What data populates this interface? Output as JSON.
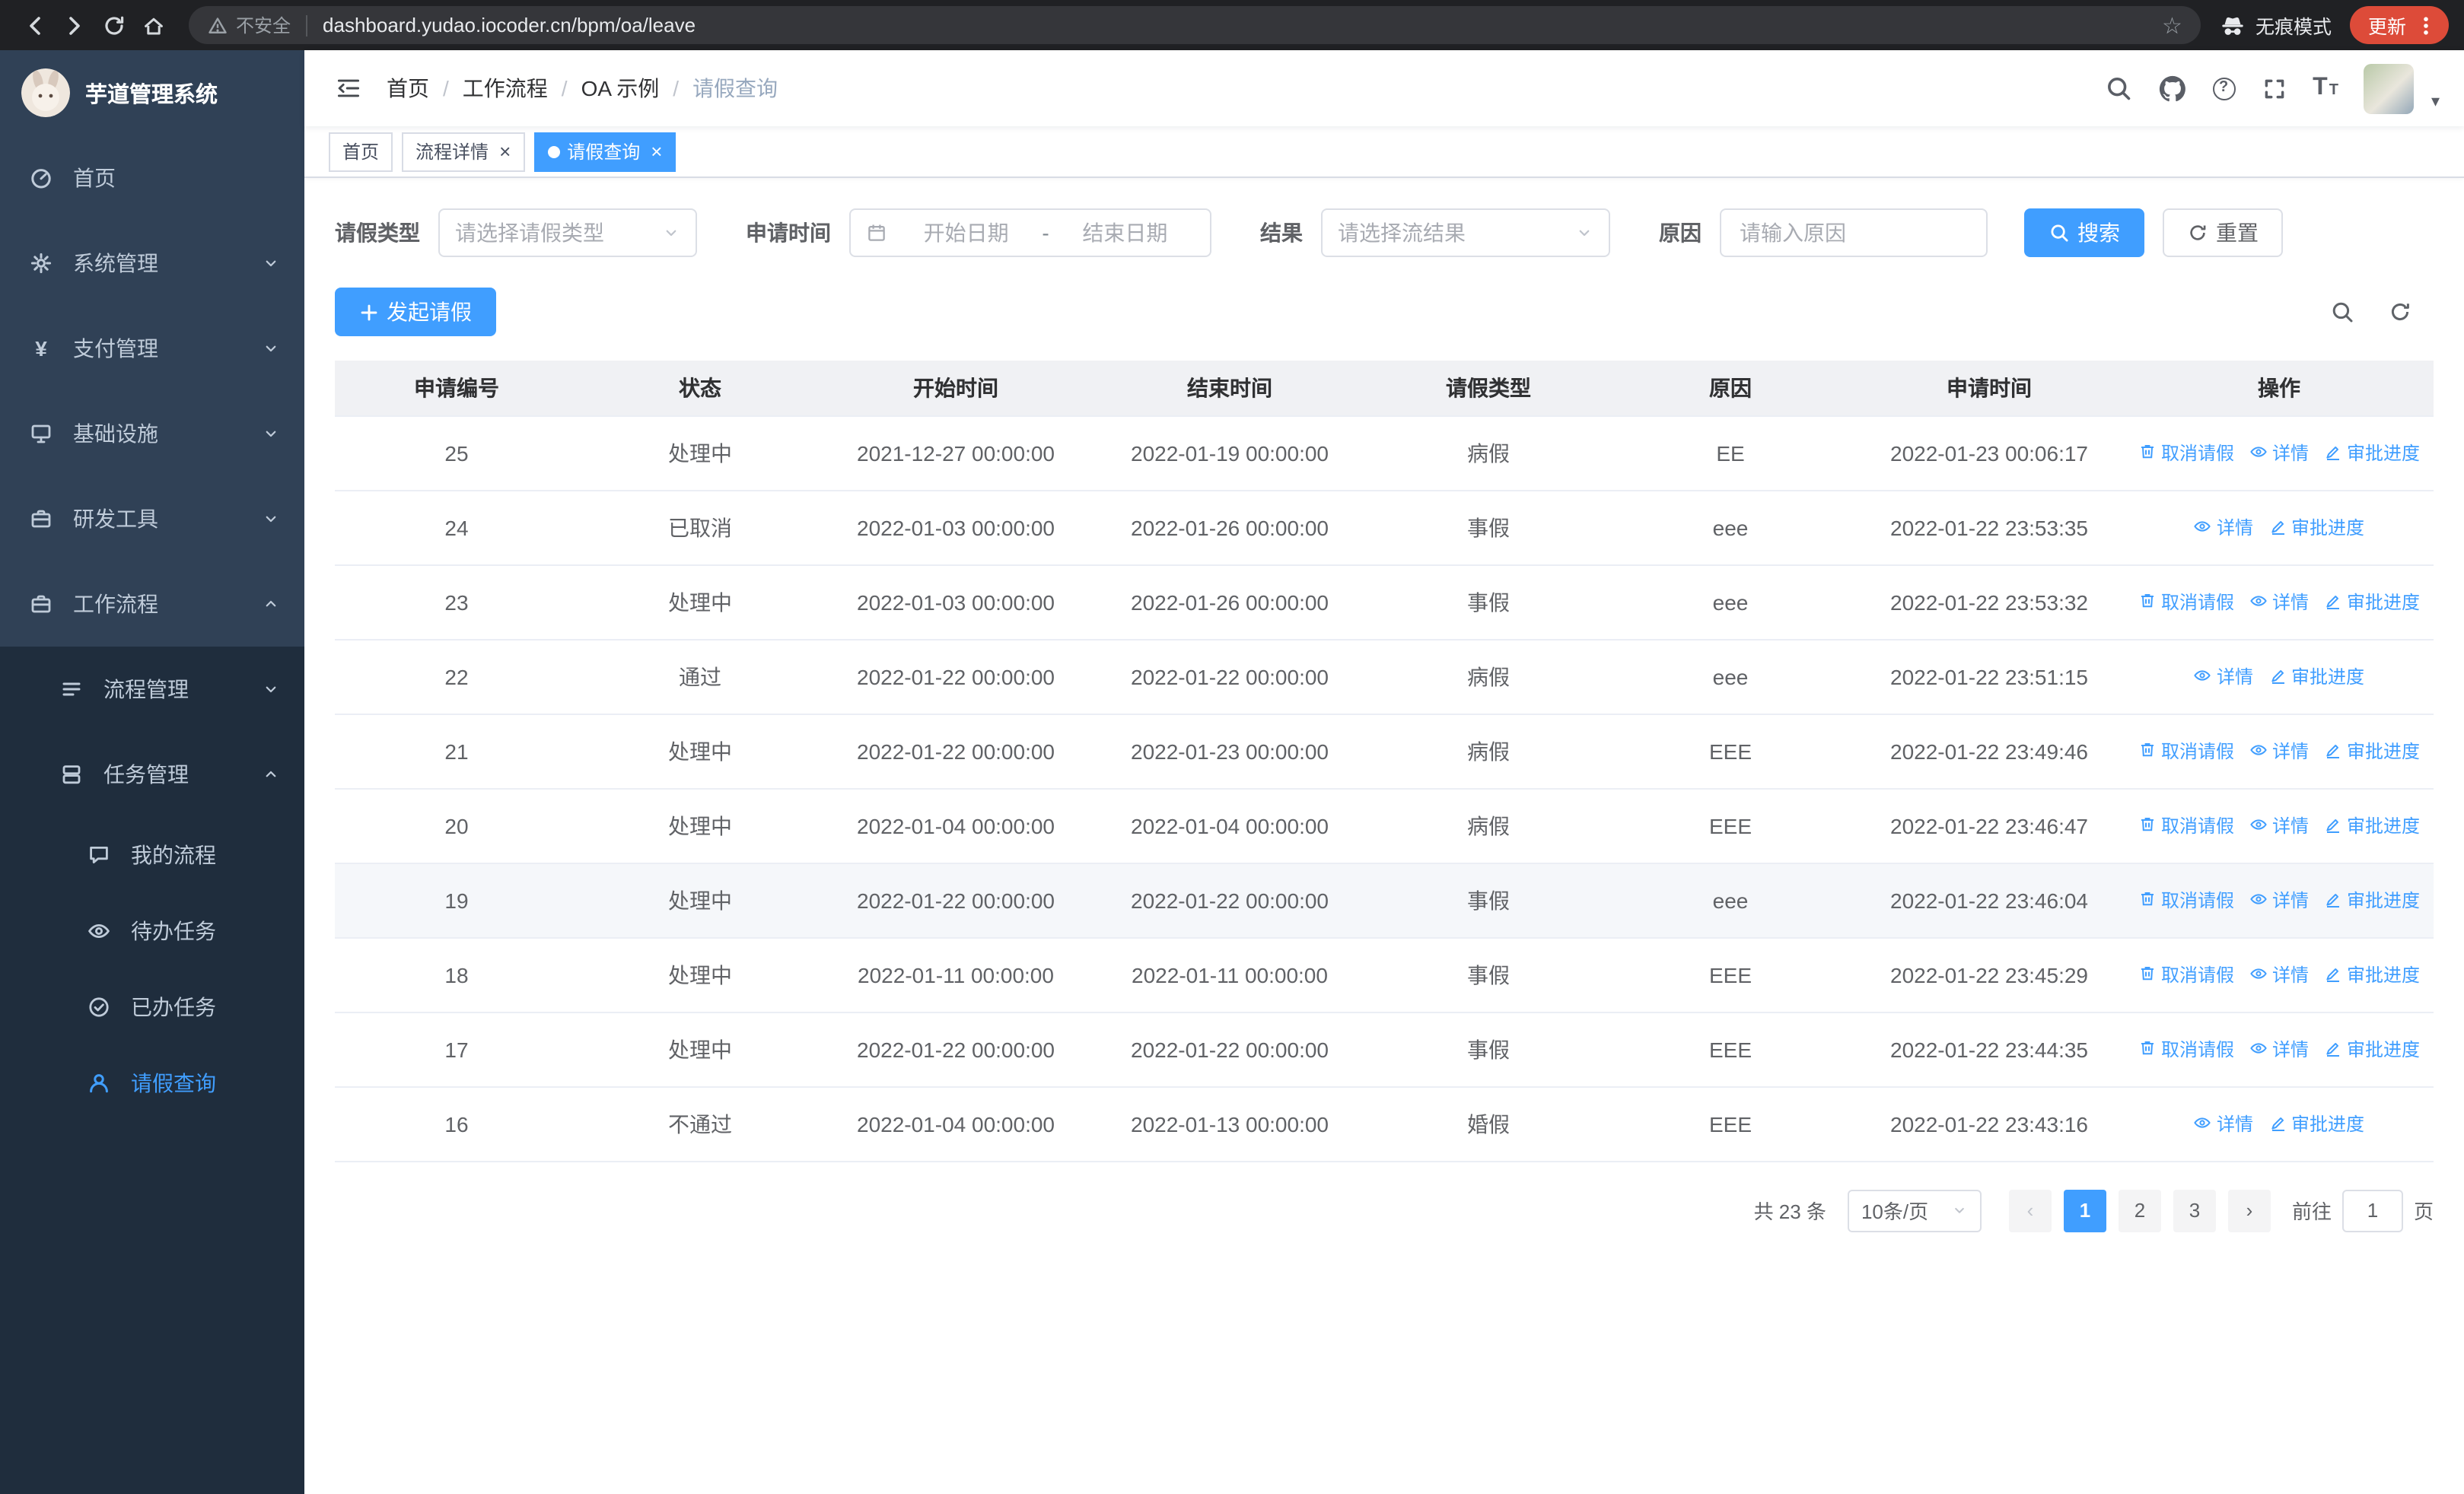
{
  "browser": {
    "security_label": "不安全",
    "url": "dashboard.yudao.iocoder.cn/bpm/oa/leave",
    "incognito_label": "无痕模式",
    "update_label": "更新"
  },
  "icons": {
    "star": "☆",
    "close": "×",
    "caret_down": "▾",
    "prev": "‹",
    "next": "›",
    "question": "?",
    "yen": "¥",
    "font_size": "T"
  },
  "sidebar": {
    "logo_title": "芋道管理系统",
    "items": [
      {
        "label": "首页",
        "icon": "dashboard-icon",
        "level": 1
      },
      {
        "label": "系统管理",
        "icon": "gear-icon",
        "level": 1,
        "expandable": true,
        "expanded": false
      },
      {
        "label": "支付管理",
        "icon": "yen-icon",
        "level": 1,
        "expandable": true,
        "expanded": false
      },
      {
        "label": "基础设施",
        "icon": "monitor-icon",
        "level": 1,
        "expandable": true,
        "expanded": false
      },
      {
        "label": "研发工具",
        "icon": "briefcase-icon",
        "level": 1,
        "expandable": true,
        "expanded": false
      },
      {
        "label": "工作流程",
        "icon": "briefcase-icon",
        "level": 1,
        "expandable": true,
        "expanded": true
      },
      {
        "label": "流程管理",
        "icon": "list-icon",
        "level": 2,
        "expandable": true,
        "expanded": false
      },
      {
        "label": "任务管理",
        "icon": "stacked-icon",
        "level": 2,
        "expandable": true,
        "expanded": true
      },
      {
        "label": "我的流程",
        "icon": "chat-icon",
        "level": 3
      },
      {
        "label": "待办任务",
        "icon": "eye-icon",
        "level": 3
      },
      {
        "label": "已办任务",
        "icon": "check-circle-icon",
        "level": 3
      },
      {
        "label": "请假查询",
        "icon": "user-icon",
        "level": 3,
        "active": true
      }
    ]
  },
  "header": {
    "breadcrumb": [
      "首页",
      "工作流程",
      "OA 示例",
      "请假查询"
    ],
    "breadcrumb_separator": "/",
    "right_icons": [
      "search-icon",
      "github-icon",
      "help-icon",
      "fullscreen-icon",
      "font-size-icon",
      "avatar",
      "caret-down-icon"
    ]
  },
  "tags": [
    {
      "label": "首页",
      "closable": false,
      "active": false
    },
    {
      "label": "流程详情",
      "closable": true,
      "active": false
    },
    {
      "label": "请假查询",
      "closable": true,
      "active": true
    }
  ],
  "filters": {
    "leave_type_label": "请假类型",
    "leave_type_placeholder": "请选择请假类型",
    "apply_time_label": "申请时间",
    "start_date_placeholder": "开始日期",
    "range_separator": "-",
    "end_date_placeholder": "结束日期",
    "result_label": "结果",
    "result_placeholder": "请选择流结果",
    "reason_label": "原因",
    "reason_placeholder": "请输入原因",
    "search_label": "搜索",
    "reset_label": "重置"
  },
  "toolbar": {
    "create_label": "发起请假"
  },
  "table": {
    "columns": [
      "申请编号",
      "状态",
      "开始时间",
      "结束时间",
      "请假类型",
      "原因",
      "申请时间",
      "操作"
    ],
    "action_labels": {
      "cancel": "取消请假",
      "detail": "详情",
      "progress": "审批进度"
    },
    "rows": [
      {
        "id": "25",
        "status": "处理中",
        "start": "2021-12-27 00:00:00",
        "end": "2022-01-19 00:00:00",
        "type": "病假",
        "reason": "EE",
        "apply_time": "2022-01-23 00:06:17",
        "actions": [
          "cancel",
          "detail",
          "progress"
        ]
      },
      {
        "id": "24",
        "status": "已取消",
        "start": "2022-01-03 00:00:00",
        "end": "2022-01-26 00:00:00",
        "type": "事假",
        "reason": "eee",
        "apply_time": "2022-01-22 23:53:35",
        "actions": [
          "detail",
          "progress"
        ]
      },
      {
        "id": "23",
        "status": "处理中",
        "start": "2022-01-03 00:00:00",
        "end": "2022-01-26 00:00:00",
        "type": "事假",
        "reason": "eee",
        "apply_time": "2022-01-22 23:53:32",
        "actions": [
          "cancel",
          "detail",
          "progress"
        ]
      },
      {
        "id": "22",
        "status": "通过",
        "start": "2022-01-22 00:00:00",
        "end": "2022-01-22 00:00:00",
        "type": "病假",
        "reason": "eee",
        "apply_time": "2022-01-22 23:51:15",
        "actions": [
          "detail",
          "progress"
        ]
      },
      {
        "id": "21",
        "status": "处理中",
        "start": "2022-01-22 00:00:00",
        "end": "2022-01-23 00:00:00",
        "type": "病假",
        "reason": "EEE",
        "apply_time": "2022-01-22 23:49:46",
        "actions": [
          "cancel",
          "detail",
          "progress"
        ]
      },
      {
        "id": "20",
        "status": "处理中",
        "start": "2022-01-04 00:00:00",
        "end": "2022-01-04 00:00:00",
        "type": "病假",
        "reason": "EEE",
        "apply_time": "2022-01-22 23:46:47",
        "actions": [
          "cancel",
          "detail",
          "progress"
        ]
      },
      {
        "id": "19",
        "status": "处理中",
        "start": "2022-01-22 00:00:00",
        "end": "2022-01-22 00:00:00",
        "type": "事假",
        "reason": "eee",
        "apply_time": "2022-01-22 23:46:04",
        "actions": [
          "cancel",
          "detail",
          "progress"
        ],
        "highlighted": true
      },
      {
        "id": "18",
        "status": "处理中",
        "start": "2022-01-11 00:00:00",
        "end": "2022-01-11 00:00:00",
        "type": "事假",
        "reason": "EEE",
        "apply_time": "2022-01-22 23:45:29",
        "actions": [
          "cancel",
          "detail",
          "progress"
        ]
      },
      {
        "id": "17",
        "status": "处理中",
        "start": "2022-01-22 00:00:00",
        "end": "2022-01-22 00:00:00",
        "type": "事假",
        "reason": "EEE",
        "apply_time": "2022-01-22 23:44:35",
        "actions": [
          "cancel",
          "detail",
          "progress"
        ]
      },
      {
        "id": "16",
        "status": "不通过",
        "start": "2022-01-04 00:00:00",
        "end": "2022-01-13 00:00:00",
        "type": "婚假",
        "reason": "EEE",
        "apply_time": "2022-01-22 23:43:16",
        "actions": [
          "detail",
          "progress"
        ]
      }
    ]
  },
  "pagination": {
    "total": "共 23 条",
    "page_size": "10条/页",
    "pages": [
      "1",
      "2",
      "3"
    ],
    "current_page": "1",
    "goto_label": "前往",
    "goto_value": "1",
    "page_label": "页"
  },
  "colors": {
    "primary": "#409EFF",
    "sidebar_bg": "#304156",
    "sidebar_submenu_bg": "#1f2d3d",
    "update_button_bg": "#dd4b39",
    "table_header_bg": "#f0f1f4"
  }
}
